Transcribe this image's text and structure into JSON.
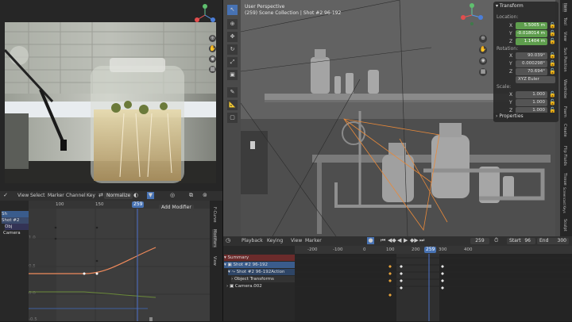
{
  "camera_view": {
    "header_icons": [
      "globe-icon",
      "camera-icon",
      "zoom-icon",
      "hand-icon",
      "grid-icon"
    ]
  },
  "graph_editor": {
    "menu": [
      "View",
      "Select",
      "Marker",
      "Channel",
      "Key"
    ],
    "normalize_label": "Normalize",
    "frame_ticks": [
      "100",
      "150",
      "200"
    ],
    "current_frame": "259",
    "value_ticks": [
      "1.0",
      "0.5",
      "0.0",
      "-0.5"
    ],
    "add_modifier": "Add Modifier",
    "side_tabs": [
      "F-Curve",
      "Modifiers",
      "View"
    ],
    "channels": [
      "Sh",
      "Shot #2",
      "Obj",
      "Camera"
    ]
  },
  "viewport": {
    "title": "User Perspective",
    "subtitle": "(259) Scene Collection | Shot #2 96-192",
    "side_tabs": [
      "Item",
      "Tool",
      "View",
      "Sun Position",
      "Wardrobe",
      "Foam",
      "Create",
      "Flip Fluids",
      "Tissue",
      "Screencast Keys",
      "Sculpt"
    ]
  },
  "transform": {
    "title": "Transform",
    "location_label": "Location:",
    "location": [
      {
        "axis": "X",
        "value": "5.5005 m"
      },
      {
        "axis": "Y",
        "value": "-0.018014 m"
      },
      {
        "axis": "Z",
        "value": "1.1404 m"
      }
    ],
    "rotation_label": "Rotation:",
    "rotation": [
      {
        "axis": "X",
        "value": "90.039°"
      },
      {
        "axis": "Y",
        "value": "0.000298°"
      },
      {
        "axis": "Z",
        "value": "70.694°"
      }
    ],
    "rotation_mode": "XYZ Euler",
    "scale_label": "Scale:",
    "scale": [
      {
        "axis": "X",
        "value": "1.000"
      },
      {
        "axis": "Y",
        "value": "1.000"
      },
      {
        "axis": "Z",
        "value": "1.000"
      }
    ],
    "properties_label": "Properties"
  },
  "timeline": {
    "menu": [
      "Playback",
      "Keying",
      "View",
      "Marker"
    ],
    "current_frame": "259",
    "start_label": "Start",
    "start_value": "96",
    "end_label": "End",
    "end_value": "300",
    "frame_ticks": [
      "-200",
      "-100",
      "0",
      "100",
      "200",
      "300",
      "400"
    ],
    "rows": [
      "Summary",
      "Shot #2 96-192",
      "Shot #2 96-192Action",
      "Object Transforms",
      "Camera.002"
    ]
  },
  "colors": {
    "accent": "#4772b3",
    "keyframe": "#e8a33a",
    "current_frame": "#4b70c9",
    "curve": "#f08a5b"
  }
}
